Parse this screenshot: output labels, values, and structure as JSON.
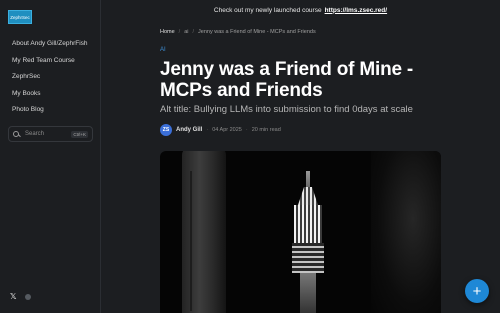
{
  "announcement": {
    "text": "Check out my newly launched course",
    "link": "https://lms.zsec.red/"
  },
  "sidebar": {
    "logo_text": "ZephrSec",
    "items": [
      {
        "label": "About Andy Gill/ZephrFish"
      },
      {
        "label": "My Red Team Course"
      },
      {
        "label": "ZephrSec"
      },
      {
        "label": "My Books"
      },
      {
        "label": "Photo Blog"
      }
    ],
    "search": {
      "placeholder": "Search",
      "shortcut": "Ctrl+K"
    },
    "social": {
      "x_icon": "x-logo-icon",
      "github_icon": "github-icon"
    }
  },
  "breadcrumb": {
    "home": "Home",
    "section": "ai",
    "current": "Jenny was a Friend of Mine - MCPs and Friends"
  },
  "post": {
    "tag": "AI",
    "title": "Jenny was a Friend of Mine - MCPs and Friends",
    "subtitle": "Alt title: Bullying LLMs into submission to find 0days at scale",
    "avatar_initials": "ZS",
    "author": "Andy Gill",
    "date": "04 Apr 2025",
    "read_time": "20 min read"
  },
  "fab": {
    "label": "+"
  },
  "colors": {
    "accent": "#1e88d6",
    "background": "#1c1e21",
    "tag": "#3e8fd6"
  }
}
